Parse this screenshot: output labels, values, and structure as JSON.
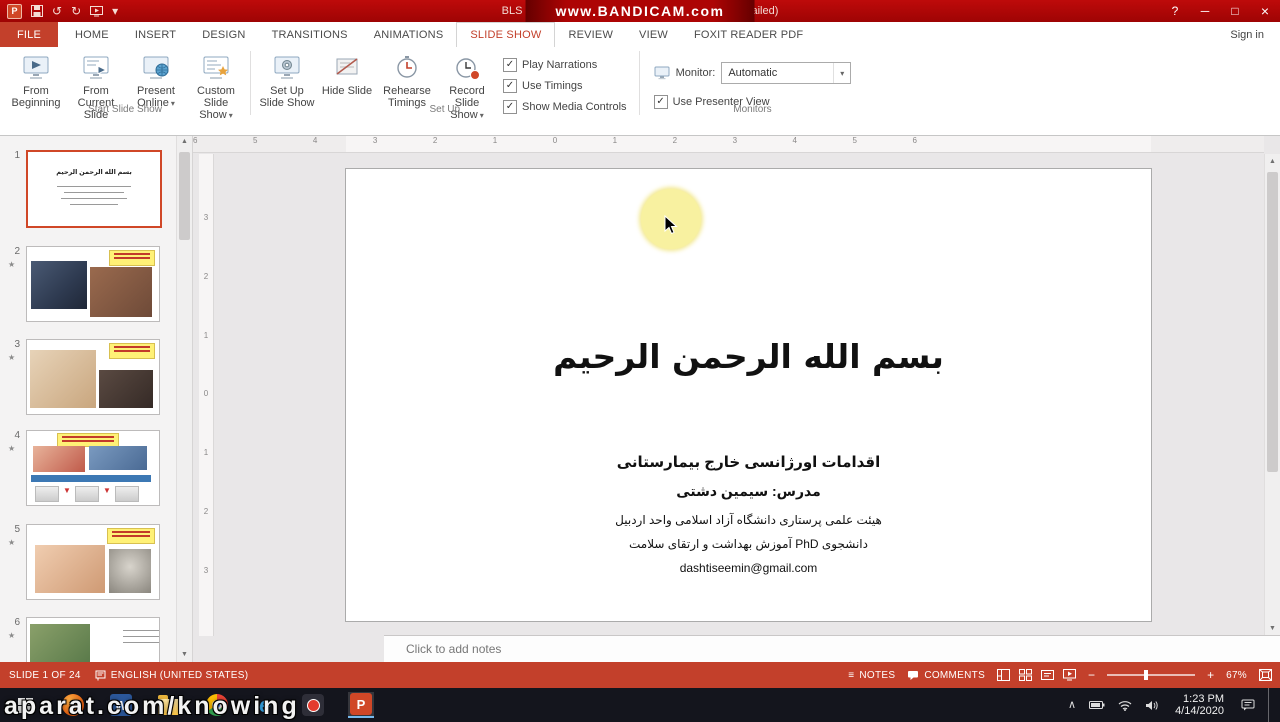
{
  "titlebar": {
    "title": "BLS - Copy.pptx - PowerPoint (Product Activation Failed)",
    "watermark": "www.BANDICAM.com"
  },
  "icons": {
    "help": "?",
    "minimize": "─",
    "maximize": "□",
    "close": "×",
    "undo": "↺",
    "redo": "↻",
    "caret_down": "▾",
    "star": "★",
    "notes_glyph": "≡",
    "chevron_up": "∧",
    "arrow_up": "▲",
    "arrow_down": "▼",
    "zoom_out": "−",
    "zoom_in": "+",
    "app_letter_p": "P",
    "app_letter_w": "W",
    "app_letter_e": "e"
  },
  "ribbon": {
    "tabs": [
      "FILE",
      "HOME",
      "INSERT",
      "DESIGN",
      "TRANSITIONS",
      "ANIMATIONS",
      "SLIDE SHOW",
      "REVIEW",
      "VIEW",
      "FOXIT READER PDF"
    ],
    "active_tab": "SLIDE SHOW",
    "sign_in": "Sign in",
    "start_group": {
      "label": "Start Slide Show",
      "from_beginning": "From Beginning",
      "from_current": "From Current Slide",
      "present_online": "Present Online",
      "custom_show": "Custom Slide Show"
    },
    "setup_group": {
      "label": "Set Up",
      "setup_show": "Set Up Slide Show",
      "hide_slide": "Hide Slide",
      "rehearse": "Rehearse Timings",
      "record": "Record Slide Show",
      "play_narrations": "Play Narrations",
      "use_timings": "Use Timings",
      "show_media_controls": "Show Media Controls"
    },
    "monitors_group": {
      "label": "Monitors",
      "monitor_label": "Monitor:",
      "monitor_value": "Automatic",
      "presenter_view": "Use Presenter View"
    }
  },
  "ruler": {
    "h": [
      "6",
      "5",
      "4",
      "3",
      "2",
      "1",
      "0",
      "1",
      "2",
      "3",
      "4",
      "5",
      "6"
    ],
    "v": [
      "3",
      "2",
      "1",
      "0",
      "1",
      "2",
      "3"
    ]
  },
  "thumbnails": [
    {
      "number": "1",
      "starred": false,
      "selected": true
    },
    {
      "number": "2",
      "starred": true,
      "selected": false
    },
    {
      "number": "3",
      "starred": true,
      "selected": false
    },
    {
      "number": "4",
      "starred": true,
      "selected": false
    },
    {
      "number": "5",
      "starred": true,
      "selected": false
    },
    {
      "number": "6",
      "starred": true,
      "selected": false
    }
  ],
  "slide": {
    "title": "بسم الله الرحمن الرحیم",
    "line1": "اقدامات اورژانسی خارج بیمارستانی",
    "line2": "مدرس: سیمین دشتی",
    "line3": "هیئت علمی پرستاری دانشگاه آزاد اسلامی واحد اردبیل",
    "line4": "دانشجوی PhD آموزش بهداشت و ارتقای سلامت",
    "line5": "dashtiseemin@gmail.com"
  },
  "notes": {
    "placeholder": "Click to add notes"
  },
  "statusbar": {
    "slide_info": "SLIDE 1 OF 24",
    "language": "ENGLISH (UNITED STATES)",
    "notes": "NOTES",
    "comments": "COMMENTS",
    "zoom_percent": "67%"
  },
  "taskbar": {
    "watermark": "aparat.com/knowing",
    "time": "1:23 PM",
    "date": "4/14/2020"
  },
  "colors": {
    "accent_red": "#C3402B",
    "bandicam_red": "#AD0404",
    "selection_orange": "#D04727",
    "highlight_yellow": "#F8F1A0"
  }
}
